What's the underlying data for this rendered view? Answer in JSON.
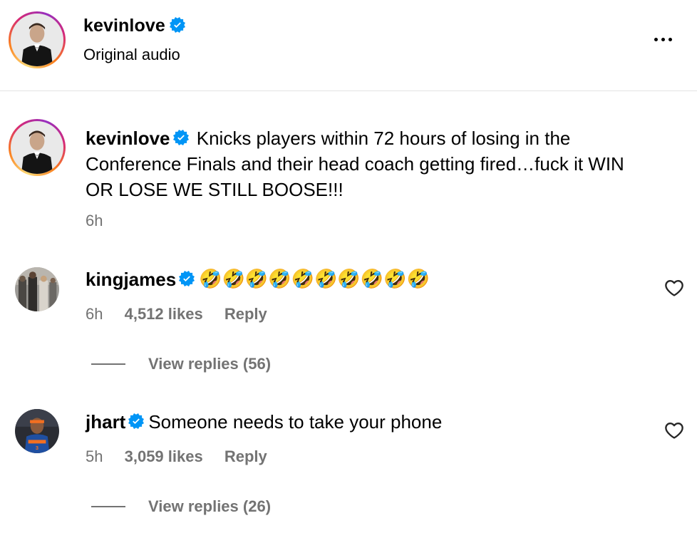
{
  "header": {
    "username": "kevinlove",
    "subtitle": "Original audio",
    "more_icon": "more-horizontal-icon"
  },
  "caption": {
    "username": "kevinlove",
    "text": "Knicks players within 72 hours of losing in the Conference Finals and their head coach getting fired…fuck it WIN OR LOSE WE STILL BOOSE!!!",
    "time": "6h"
  },
  "comments": [
    {
      "username": "kingjames",
      "verified": true,
      "text": "🤣🤣🤣🤣🤣🤣🤣🤣🤣🤣",
      "time": "6h",
      "likes": "4,512 likes",
      "reply_label": "Reply",
      "view_replies": "View replies (56)"
    },
    {
      "username": "jhart",
      "verified": true,
      "text": "Someone needs to take your phone",
      "time": "5h",
      "likes": "3,059 likes",
      "reply_label": "Reply",
      "view_replies": "View replies (26)"
    }
  ],
  "colors": {
    "verified_badge": "#0095f6",
    "secondary_text": "#737373",
    "divider": "#e4e4e4"
  }
}
